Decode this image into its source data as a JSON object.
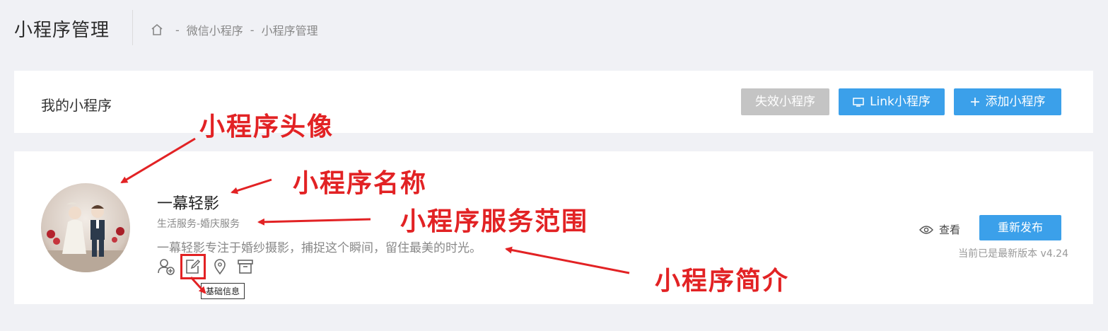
{
  "header": {
    "title": "小程序管理",
    "breadcrumb": [
      "微信小程序",
      "小程序管理"
    ],
    "separator": "-"
  },
  "panel1": {
    "title": "我的小程序",
    "buttons": {
      "invalid": "失效小程序",
      "link": "Link小程序",
      "add": "添加小程序"
    }
  },
  "app": {
    "name": "一幕轻影",
    "category": "生活服务-婚庆服务",
    "description": "一幕轻影专注于婚纱摄影，捕捉这个瞬间，留住最美的时光。",
    "tooltip": "基础信息",
    "view_label": "查看",
    "republish_label": "重新发布",
    "version_text": "当前已是最新版本 v4.24",
    "icons": [
      "add-member-icon",
      "edit-icon",
      "location-icon",
      "archive-icon"
    ]
  },
  "annotations": {
    "avatar": "小程序头像",
    "name": "小程序名称",
    "scope": "小程序服务范围",
    "intro": "小程序简介"
  },
  "colors": {
    "primary": "#3ba0ea",
    "disabled": "#c4c4c4",
    "annotation": "#e22224",
    "background": "#f0f1f5"
  }
}
